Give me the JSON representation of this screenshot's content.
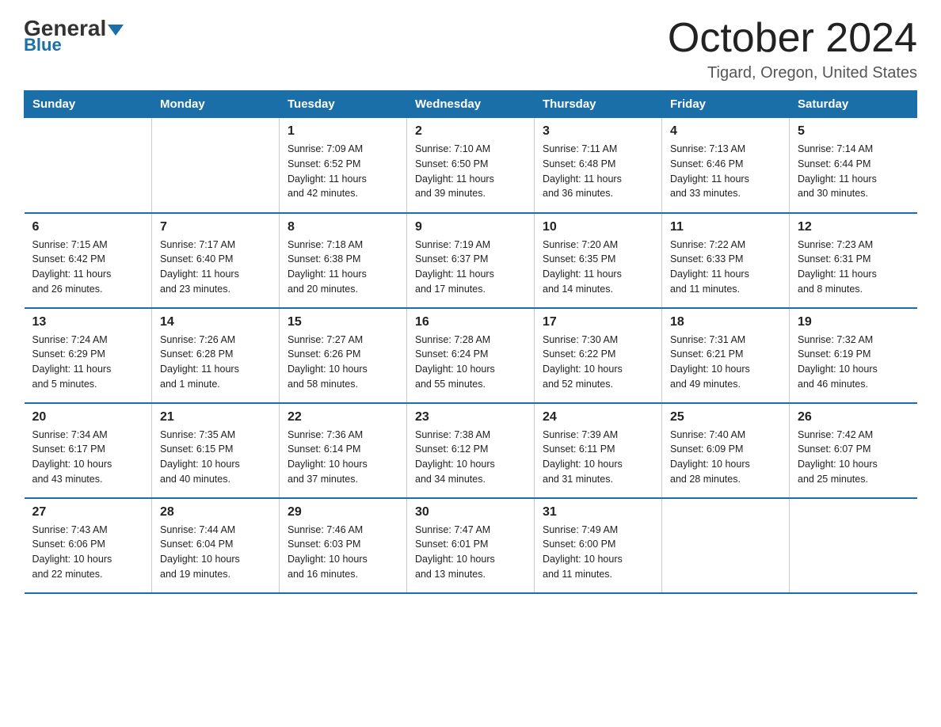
{
  "header": {
    "logo_general": "General",
    "logo_blue": "Blue",
    "month_title": "October 2024",
    "location": "Tigard, Oregon, United States"
  },
  "days_of_week": [
    "Sunday",
    "Monday",
    "Tuesday",
    "Wednesday",
    "Thursday",
    "Friday",
    "Saturday"
  ],
  "weeks": [
    [
      {
        "day": "",
        "info": ""
      },
      {
        "day": "",
        "info": ""
      },
      {
        "day": "1",
        "info": "Sunrise: 7:09 AM\nSunset: 6:52 PM\nDaylight: 11 hours\nand 42 minutes."
      },
      {
        "day": "2",
        "info": "Sunrise: 7:10 AM\nSunset: 6:50 PM\nDaylight: 11 hours\nand 39 minutes."
      },
      {
        "day": "3",
        "info": "Sunrise: 7:11 AM\nSunset: 6:48 PM\nDaylight: 11 hours\nand 36 minutes."
      },
      {
        "day": "4",
        "info": "Sunrise: 7:13 AM\nSunset: 6:46 PM\nDaylight: 11 hours\nand 33 minutes."
      },
      {
        "day": "5",
        "info": "Sunrise: 7:14 AM\nSunset: 6:44 PM\nDaylight: 11 hours\nand 30 minutes."
      }
    ],
    [
      {
        "day": "6",
        "info": "Sunrise: 7:15 AM\nSunset: 6:42 PM\nDaylight: 11 hours\nand 26 minutes."
      },
      {
        "day": "7",
        "info": "Sunrise: 7:17 AM\nSunset: 6:40 PM\nDaylight: 11 hours\nand 23 minutes."
      },
      {
        "day": "8",
        "info": "Sunrise: 7:18 AM\nSunset: 6:38 PM\nDaylight: 11 hours\nand 20 minutes."
      },
      {
        "day": "9",
        "info": "Sunrise: 7:19 AM\nSunset: 6:37 PM\nDaylight: 11 hours\nand 17 minutes."
      },
      {
        "day": "10",
        "info": "Sunrise: 7:20 AM\nSunset: 6:35 PM\nDaylight: 11 hours\nand 14 minutes."
      },
      {
        "day": "11",
        "info": "Sunrise: 7:22 AM\nSunset: 6:33 PM\nDaylight: 11 hours\nand 11 minutes."
      },
      {
        "day": "12",
        "info": "Sunrise: 7:23 AM\nSunset: 6:31 PM\nDaylight: 11 hours\nand 8 minutes."
      }
    ],
    [
      {
        "day": "13",
        "info": "Sunrise: 7:24 AM\nSunset: 6:29 PM\nDaylight: 11 hours\nand 5 minutes."
      },
      {
        "day": "14",
        "info": "Sunrise: 7:26 AM\nSunset: 6:28 PM\nDaylight: 11 hours\nand 1 minute."
      },
      {
        "day": "15",
        "info": "Sunrise: 7:27 AM\nSunset: 6:26 PM\nDaylight: 10 hours\nand 58 minutes."
      },
      {
        "day": "16",
        "info": "Sunrise: 7:28 AM\nSunset: 6:24 PM\nDaylight: 10 hours\nand 55 minutes."
      },
      {
        "day": "17",
        "info": "Sunrise: 7:30 AM\nSunset: 6:22 PM\nDaylight: 10 hours\nand 52 minutes."
      },
      {
        "day": "18",
        "info": "Sunrise: 7:31 AM\nSunset: 6:21 PM\nDaylight: 10 hours\nand 49 minutes."
      },
      {
        "day": "19",
        "info": "Sunrise: 7:32 AM\nSunset: 6:19 PM\nDaylight: 10 hours\nand 46 minutes."
      }
    ],
    [
      {
        "day": "20",
        "info": "Sunrise: 7:34 AM\nSunset: 6:17 PM\nDaylight: 10 hours\nand 43 minutes."
      },
      {
        "day": "21",
        "info": "Sunrise: 7:35 AM\nSunset: 6:15 PM\nDaylight: 10 hours\nand 40 minutes."
      },
      {
        "day": "22",
        "info": "Sunrise: 7:36 AM\nSunset: 6:14 PM\nDaylight: 10 hours\nand 37 minutes."
      },
      {
        "day": "23",
        "info": "Sunrise: 7:38 AM\nSunset: 6:12 PM\nDaylight: 10 hours\nand 34 minutes."
      },
      {
        "day": "24",
        "info": "Sunrise: 7:39 AM\nSunset: 6:11 PM\nDaylight: 10 hours\nand 31 minutes."
      },
      {
        "day": "25",
        "info": "Sunrise: 7:40 AM\nSunset: 6:09 PM\nDaylight: 10 hours\nand 28 minutes."
      },
      {
        "day": "26",
        "info": "Sunrise: 7:42 AM\nSunset: 6:07 PM\nDaylight: 10 hours\nand 25 minutes."
      }
    ],
    [
      {
        "day": "27",
        "info": "Sunrise: 7:43 AM\nSunset: 6:06 PM\nDaylight: 10 hours\nand 22 minutes."
      },
      {
        "day": "28",
        "info": "Sunrise: 7:44 AM\nSunset: 6:04 PM\nDaylight: 10 hours\nand 19 minutes."
      },
      {
        "day": "29",
        "info": "Sunrise: 7:46 AM\nSunset: 6:03 PM\nDaylight: 10 hours\nand 16 minutes."
      },
      {
        "day": "30",
        "info": "Sunrise: 7:47 AM\nSunset: 6:01 PM\nDaylight: 10 hours\nand 13 minutes."
      },
      {
        "day": "31",
        "info": "Sunrise: 7:49 AM\nSunset: 6:00 PM\nDaylight: 10 hours\nand 11 minutes."
      },
      {
        "day": "",
        "info": ""
      },
      {
        "day": "",
        "info": ""
      }
    ]
  ]
}
